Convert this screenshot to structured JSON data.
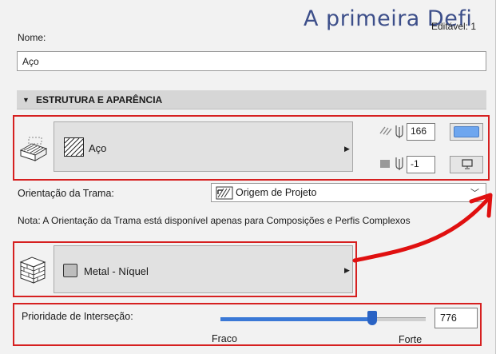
{
  "header": {
    "title_overlay": "A primeira Defi",
    "editable_label": "Editável: 1"
  },
  "name": {
    "label": "Nome:",
    "value": "Aço"
  },
  "section": {
    "title": "ESTRUTURA E APARÊNCIA"
  },
  "structure": {
    "fill_label": "Aço",
    "hatch_pen_value": "166",
    "background_pen_value": "-1"
  },
  "orientation": {
    "label": "Orientação da Trama:",
    "selected": "Origem de Projeto",
    "note": "Nota: A Orientação da Trama está disponível apenas para Composições e Perfis Complexos"
  },
  "material": {
    "label": "Metal - Níquel",
    "swatch_color": "#bdbdbd"
  },
  "priority": {
    "label": "Prioridade de Interseção:",
    "value": "776",
    "slider_level_percent": 74,
    "min_label": "Fraco",
    "max_label": "Forte"
  },
  "colors": {
    "accent": "#3a78d6",
    "highlight_red": "#d62020",
    "overlay_text": "#3d4f8a"
  },
  "icons": [
    "building-element-icon",
    "hatch-fill-icon",
    "pen-hatch-icon",
    "pen-background-icon",
    "display-icon",
    "project-origin-icon",
    "brick-wall-icon",
    "chevron-down-icon",
    "arrow-right-icon"
  ]
}
